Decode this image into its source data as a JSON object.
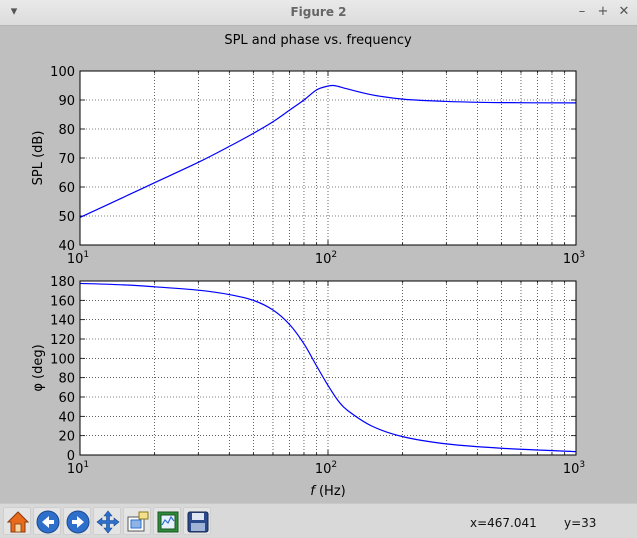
{
  "window": {
    "title": "Figure 2"
  },
  "window_buttons": {
    "menu": "▾",
    "minimize": "–",
    "maximize": "+",
    "close": "✕"
  },
  "figure": {
    "suptitle": "SPL and phase vs. frequency"
  },
  "toolbar": {
    "buttons": [
      {
        "name": "home-button",
        "icon": "home-icon"
      },
      {
        "name": "back-button",
        "icon": "arrow-left-icon"
      },
      {
        "name": "forward-button",
        "icon": "arrow-right-icon"
      },
      {
        "name": "pan-button",
        "icon": "move-arrows-icon"
      },
      {
        "name": "zoom-button",
        "icon": "zoom-rect-icon"
      },
      {
        "name": "subplots-button",
        "icon": "configure-subplots-icon"
      },
      {
        "name": "save-button",
        "icon": "floppy-disk-icon"
      }
    ],
    "x_readout": "x=467.041",
    "y_readout": "y=33"
  },
  "colors": {
    "line": "#0000ff",
    "background": "#bfbfbf",
    "axes_face": "#ffffff"
  },
  "chart_data": [
    {
      "type": "line",
      "title": "",
      "xlabel": "",
      "ylabel": "SPL (dB)",
      "xscale": "log",
      "xlim": [
        10,
        1000
      ],
      "ylim": [
        40,
        100
      ],
      "x_ticks": [
        "10^1",
        "10^2",
        "10^3"
      ],
      "y_ticks": [
        "40",
        "50",
        "60",
        "70",
        "80",
        "90",
        "100"
      ],
      "grid": true,
      "series": [
        {
          "x": [
            10,
            15,
            20,
            30,
            40,
            50,
            60,
            70,
            80,
            90,
            100,
            105,
            110,
            120,
            150,
            200,
            300,
            500,
            1000
          ],
          "y": [
            49.5,
            56.5,
            61.5,
            68.5,
            74.0,
            78.5,
            82.5,
            86.5,
            90.0,
            93.5,
            94.8,
            95.0,
            94.7,
            93.8,
            91.8,
            90.3,
            89.5,
            89.1,
            89.0
          ]
        }
      ]
    },
    {
      "type": "line",
      "title": "",
      "xlabel": "f (Hz)",
      "ylabel": "φ (deg)",
      "xscale": "log",
      "xlim": [
        10,
        1000
      ],
      "ylim": [
        0,
        180
      ],
      "x_ticks": [
        "10^1",
        "10^2",
        "10^3"
      ],
      "y_ticks": [
        "0",
        "20",
        "40",
        "60",
        "80",
        "100",
        "120",
        "140",
        "160",
        "180"
      ],
      "grid": true,
      "series": [
        {
          "x": [
            10,
            15,
            20,
            30,
            40,
            50,
            60,
            70,
            80,
            90,
            100,
            110,
            120,
            150,
            200,
            300,
            500,
            1000
          ],
          "y": [
            177.5,
            176.0,
            174.0,
            170.5,
            166.0,
            160.0,
            150.0,
            135.0,
            115.0,
            92.0,
            72.0,
            56.0,
            46.0,
            30.0,
            19.0,
            11.5,
            7.0,
            3.5
          ]
        }
      ]
    }
  ]
}
